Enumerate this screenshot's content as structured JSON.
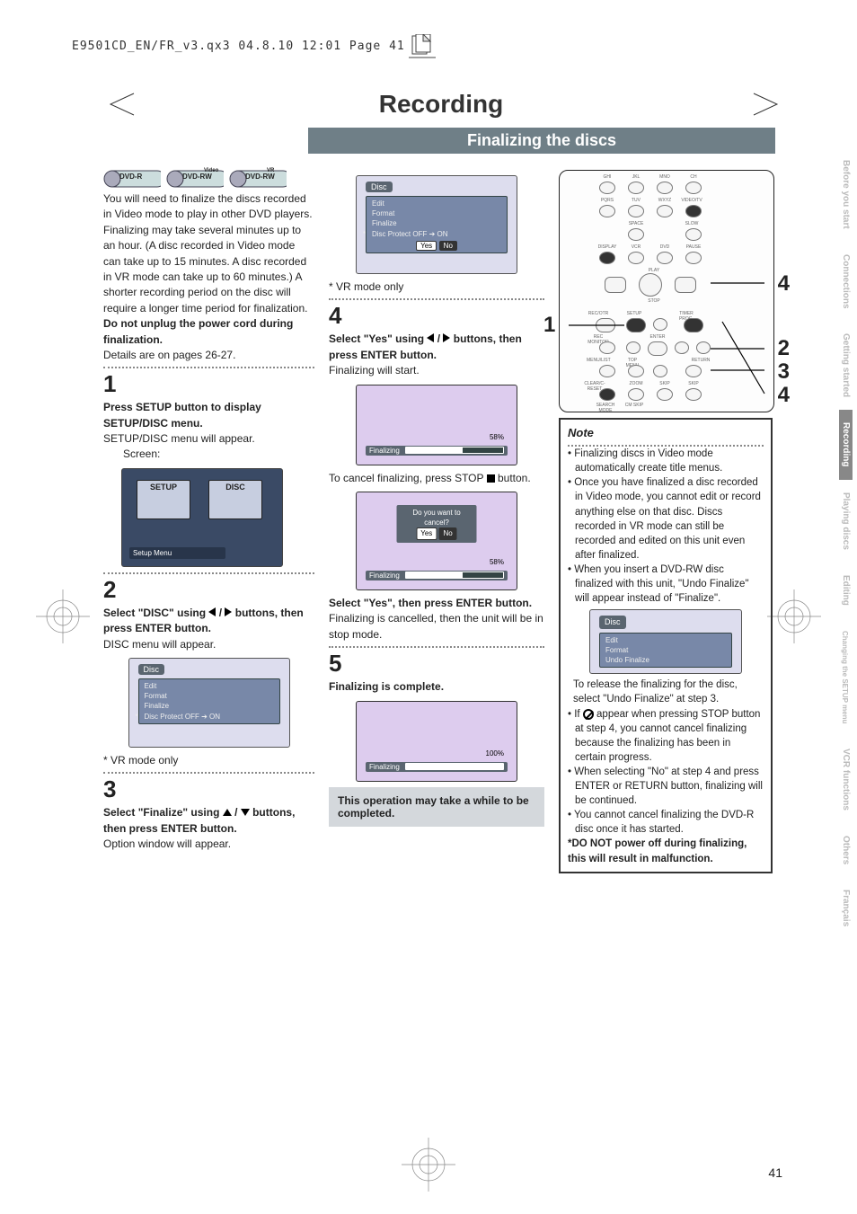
{
  "print_header": "E9501CD_EN/FR_v3.qx3  04.8.10  12:01  Page 41",
  "title": "Recording",
  "subtitle": "Finalizing the discs",
  "badges": [
    {
      "main": "DVD-R",
      "sup": ""
    },
    {
      "main": "DVD-RW",
      "sup": "Video"
    },
    {
      "main": "DVD-RW",
      "sup": "VR"
    }
  ],
  "intro": {
    "p1": "You will need to finalize the discs recorded in Video mode to play in other DVD players.",
    "p2": "Finalizing may take several minutes up to an hour. (A disc recorded in Video mode can take up to 15 minutes. A disc recorded in VR mode can take up to 60 minutes.) A shorter recording period on the disc will require a longer time period for finalization.",
    "p3": "Do not unplug the power cord during finalization.",
    "p4": "Details are on pages 26-27."
  },
  "step1": {
    "num": "1",
    "heading": "Press SETUP button to display SETUP/DISC menu.",
    "sub": "SETUP/DISC menu will appear.",
    "screen_label": "Screen:",
    "tile1": "SETUP",
    "tile2": "DISC",
    "caption": "Setup Menu"
  },
  "step2": {
    "num": "2",
    "heading_a": "Select \"DISC\" using ",
    "heading_b": " buttons, then press ENTER button.",
    "sub": "DISC menu will appear.",
    "screen": {
      "title": "Disc",
      "rows": [
        "Edit",
        "Format",
        "Finalize",
        "Disc Protect OFF ➔ ON"
      ]
    },
    "footnote": "* VR mode only"
  },
  "step3": {
    "num": "3",
    "heading_a": "Select \"Finalize\" using ",
    "heading_b": " buttons, then press ENTER button.",
    "sub": "Option window will appear."
  },
  "center": {
    "pre_screen": {
      "title": "Disc",
      "rows": [
        "Edit",
        "Format",
        "Finalize",
        "Disc Protect OFF ➔ ON"
      ],
      "yes": "Yes",
      "no": "No"
    },
    "footnote": "* VR mode only",
    "step4num": "4",
    "s4_heading_a": "Select \"Yes\" using ",
    "s4_heading_b": " buttons, then press ENTER button.",
    "s4_sub": "Finalizing will start.",
    "finalizing_label": "Finalizing",
    "finalizing_pct": "58%",
    "cancel_text": "To cancel finalizing, press STOP ",
    "cancel_text2": " button.",
    "cancel_box": {
      "msg": "Do you want to cancel?",
      "yes": "Yes",
      "no": "No",
      "label": "Finalizing",
      "pct": "58%"
    },
    "yes_heading": "Select \"Yes\", then press ENTER button.",
    "yes_sub": "Finalizing is cancelled, then the unit will be in stop mode.",
    "step5num": "5",
    "s5_heading": "Finalizing is complete.",
    "complete": {
      "label": "Finalizing",
      "pct": "100%"
    },
    "callout": "This operation may take a while to be completed."
  },
  "remote": {
    "left_num": "1",
    "r4": "4",
    "r2": "2",
    "r3": "3",
    "r4b": "4"
  },
  "note": {
    "hdr": "Note",
    "b1": "Finalizing discs in Video mode automatically create title menus.",
    "b2": "Once you have finalized a disc recorded in Video mode, you cannot edit or record anything else on that disc. Discs recorded in VR mode can still be recorded and edited on this unit even after finalized.",
    "b3": "When you insert a DVD-RW disc finalized with this unit, \"Undo Finalize\" will appear instead of  \"Finalize\".",
    "undo_screen": {
      "title": "Disc",
      "rows": [
        "Edit",
        "Format",
        "Undo Finalize"
      ]
    },
    "after1": "To release the finalizing for the disc, select \"Undo Finalize\" at step 3.",
    "b4": " appear when pressing STOP button at step 4, you cannot cancel finalizing because the finalizing has been in certain progress.",
    "b4_pre": "If ",
    "b5": "When selecting \"No\" at step 4 and press ENTER or RETURN button, finalizing will be continued.",
    "b6": "You cannot cancel finalizing the DVD-R disc once it has started.",
    "b7": "*DO NOT power off during finalizing, this will result in malfunction."
  },
  "tabs": [
    "Before you start",
    "Connections",
    "Getting started",
    "Recording",
    "Playing discs",
    "Editing",
    "Changing the SETUP menu",
    "VCR functions",
    "Others",
    "Français"
  ],
  "page_num": "41"
}
